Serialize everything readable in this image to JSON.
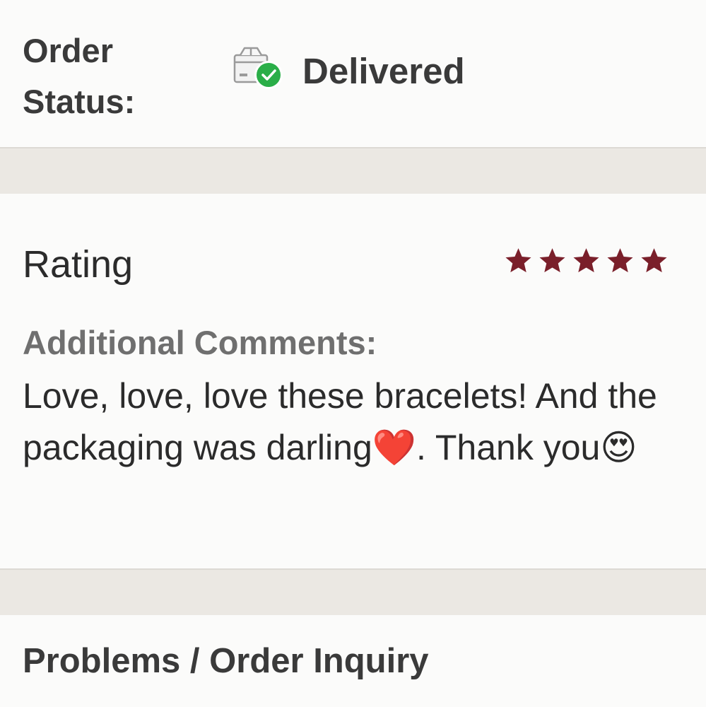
{
  "order_status": {
    "label": "Order Status:",
    "icon": "box-delivered-icon",
    "value": "Delivered"
  },
  "rating": {
    "title": "Rating",
    "stars": 5,
    "star_color": "#7a1f2a",
    "comments_label": "Additional Comments:",
    "comments_text": "Love, love, love these bracelets! And the packaging was darling❤️. Thank you😍"
  },
  "problems": {
    "title": "Problems / Order Inquiry"
  },
  "colors": {
    "background": "#fbfbfa",
    "divider": "#ebe8e3",
    "check_green": "#2aae48"
  }
}
